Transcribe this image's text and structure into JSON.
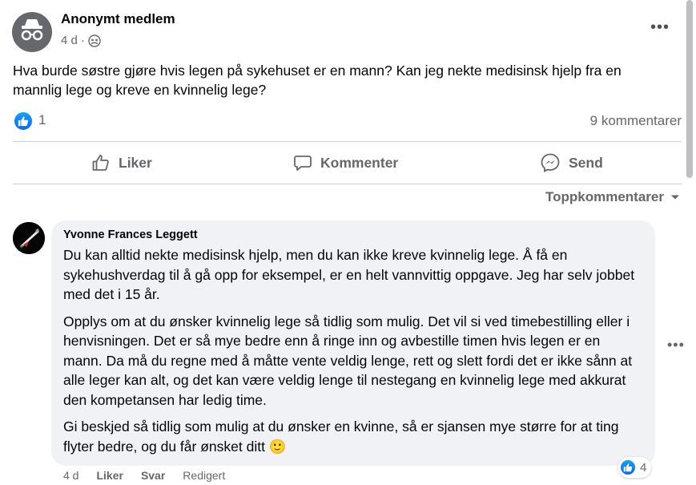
{
  "post": {
    "author": "Anonymt medlem",
    "time": "4 d",
    "more": "•••",
    "text": "Hva burde søstre gjøre hvis legen på sykehuset er en mann? Kan jeg nekte medisinsk hjelp fra en mannlig lege og kreve en kvinnelig lege?",
    "reaction_count": "1",
    "comment_count": "9 kommentarer"
  },
  "actions": {
    "like": "Liker",
    "comment": "Kommenter",
    "send": "Send"
  },
  "sort_label": "Toppkommentarer",
  "comment": {
    "author": "Yvonne Frances Leggett",
    "paragraphs": [
      "Du kan alltid nekte medisinsk hjelp, men du kan ikke kreve kvinnelig lege. Å få en sykehushverdag til å gå opp for eksempel, er en helt vannvittig oppgave. Jeg har selv jobbet med det i 15 år.",
      "Opplys om at du ønsker kvinnelig lege så tidlig som mulig. Det vil si ved timebestilling eller i henvisningen. Det er så mye bedre enn å ringe inn og avbestille timen hvis legen er en mann. Da må du regne med å måtte vente veldig lenge, rett og slett fordi det er ikke sånn at alle leger kan alt, og det kan være veldig lenge til nestegang en kvinnelig lege med akkurat den kompetansen har ledig time.",
      "Gi beskjed så tidlig som mulig at du ønsker en kvinne, så er sjansen mye større for at ting flyter bedre, og du får ønsket ditt"
    ],
    "emoji": "🙂",
    "time": "4 d",
    "like": "Liker",
    "reply": "Svar",
    "edited": "Redigert",
    "reaction_count": "4",
    "more": "•••"
  },
  "icons": {
    "privacy": "group-privacy-icon",
    "reaction": "like-reaction-icon"
  },
  "colors": {
    "accent": "#0866ff",
    "muted_text": "#65676b",
    "bubble": "#f0f2f5"
  }
}
